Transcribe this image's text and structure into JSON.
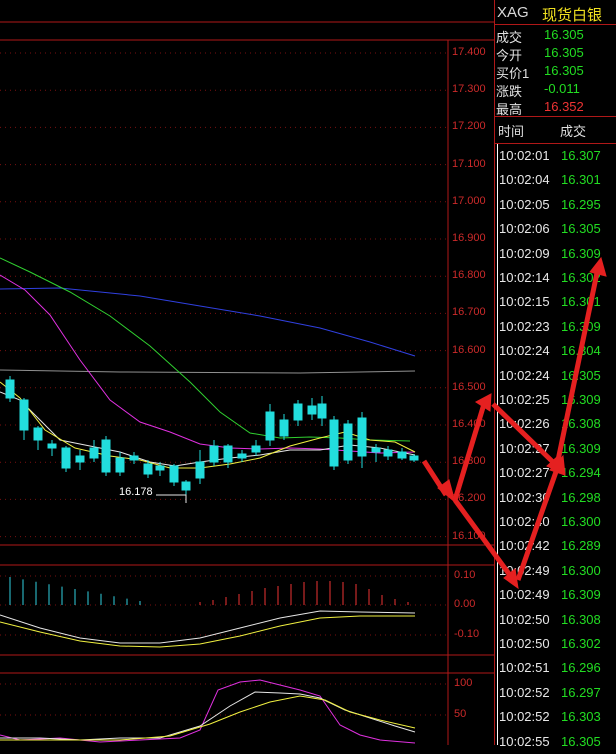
{
  "instrument": {
    "code": "XAG",
    "name": "现货白银"
  },
  "quote": [
    {
      "label": "成交",
      "value": "16.305",
      "color": "#22dd22"
    },
    {
      "label": "今开",
      "value": "16.305",
      "color": "#22dd22"
    },
    {
      "label": "买价1",
      "value": "16.305",
      "color": "#22dd22"
    },
    {
      "label": "涨跌",
      "value": "-0.011",
      "color": "#22dd22"
    },
    {
      "label": "最高",
      "value": "16.352",
      "color": "#ee3333"
    }
  ],
  "ticks_header": {
    "time": "时间",
    "price": "成交"
  },
  "ticks": [
    {
      "time": "10:02:01",
      "price": "16.307"
    },
    {
      "time": "10:02:04",
      "price": "16.301"
    },
    {
      "time": "10:02:05",
      "price": "16.295"
    },
    {
      "time": "10:02:06",
      "price": "16.305"
    },
    {
      "time": "10:02:09",
      "price": "16.309"
    },
    {
      "time": "10:02:14",
      "price": "16.302"
    },
    {
      "time": "10:02:15",
      "price": "16.301"
    },
    {
      "time": "10:02:23",
      "price": "16.309"
    },
    {
      "time": "10:02:24",
      "price": "16.304"
    },
    {
      "time": "10:02:24",
      "price": "16.305"
    },
    {
      "time": "10:02:25",
      "price": "16.309"
    },
    {
      "time": "10:02:26",
      "price": "16.308"
    },
    {
      "time": "10:02:27",
      "price": "16.309"
    },
    {
      "time": "10:02:27",
      "price": "16.294"
    },
    {
      "time": "10:02:30",
      "price": "16.298"
    },
    {
      "time": "10:02:40",
      "price": "16.300"
    },
    {
      "time": "10:02:42",
      "price": "16.289"
    },
    {
      "time": "10:02:49",
      "price": "16.300"
    },
    {
      "time": "10:02:49",
      "price": "16.309"
    },
    {
      "time": "10:02:50",
      "price": "16.308"
    },
    {
      "time": "10:02:50",
      "price": "16.302"
    },
    {
      "time": "10:02:51",
      "price": "16.296"
    },
    {
      "time": "10:02:52",
      "price": "16.297"
    },
    {
      "time": "10:02:52",
      "price": "16.303"
    },
    {
      "time": "10:02:55",
      "price": "16.305"
    }
  ],
  "price_axis": [
    "17.400",
    "17.300",
    "17.200",
    "17.100",
    "17.000",
    "16.900",
    "16.800",
    "16.700",
    "16.600",
    "16.500",
    "16.400",
    "16.300",
    "16.200",
    "16.100"
  ],
  "macd_axis": [
    "0.10",
    "0.00",
    "-0.10"
  ],
  "kdj_axis": [
    "100",
    "50"
  ],
  "low_marker": "16.178",
  "colors": {
    "up": "#ee3333",
    "down": "#22dddd",
    "ma_white": "#e6e6e6",
    "ma_yellow": "#f0f040",
    "ma_magenta": "#e030e0",
    "ma_green": "#30d030",
    "ma_blue": "#3040e0",
    "ma_gray": "#909090",
    "annotation": "#ee2020"
  }
}
